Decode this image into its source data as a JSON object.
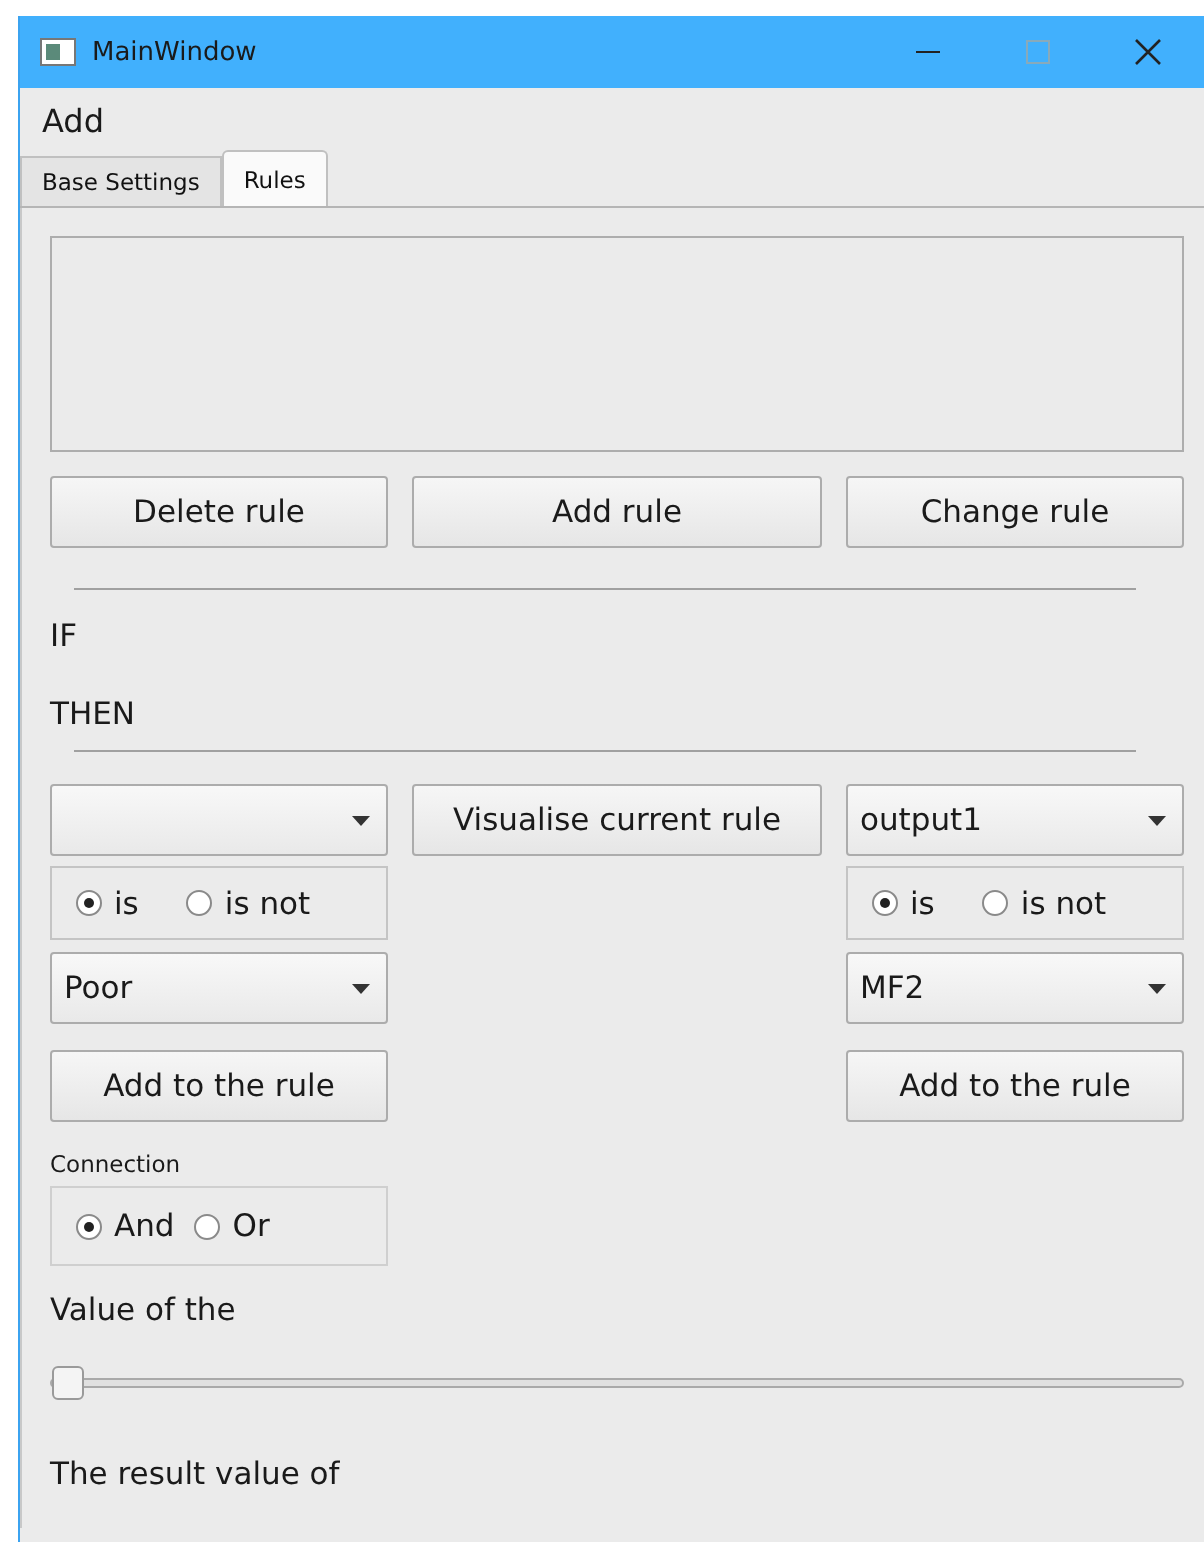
{
  "window": {
    "title": "MainWindow"
  },
  "menu": [
    "Add"
  ],
  "tabs": [
    {
      "label": "Base Settings",
      "selected": false
    },
    {
      "label": "Rules",
      "selected": true
    }
  ],
  "rule_buttons": [
    "Delete rule",
    "Add rule",
    "Change rule"
  ],
  "if_label": "IF",
  "then_label": "THEN",
  "visualise_button": "Visualise current rule",
  "if_side": {
    "radios": [
      {
        "label": "is",
        "selected": true
      },
      {
        "label": "is not",
        "selected": false
      }
    ],
    "term": "Poor",
    "add_button": "Add to the rule"
  },
  "then_side": {
    "variable": "output1",
    "radios": [
      {
        "label": "is",
        "selected": true
      },
      {
        "label": "is not",
        "selected": false
      }
    ],
    "term": "MF2",
    "add_button": "Add to the rule"
  },
  "connection": {
    "label": "Connection",
    "options": [
      {
        "label": "And",
        "selected": true
      },
      {
        "label": "Or",
        "selected": false
      }
    ]
  },
  "slider": {
    "label": "Value of the",
    "level": 0
  },
  "result_label": "The result value of"
}
